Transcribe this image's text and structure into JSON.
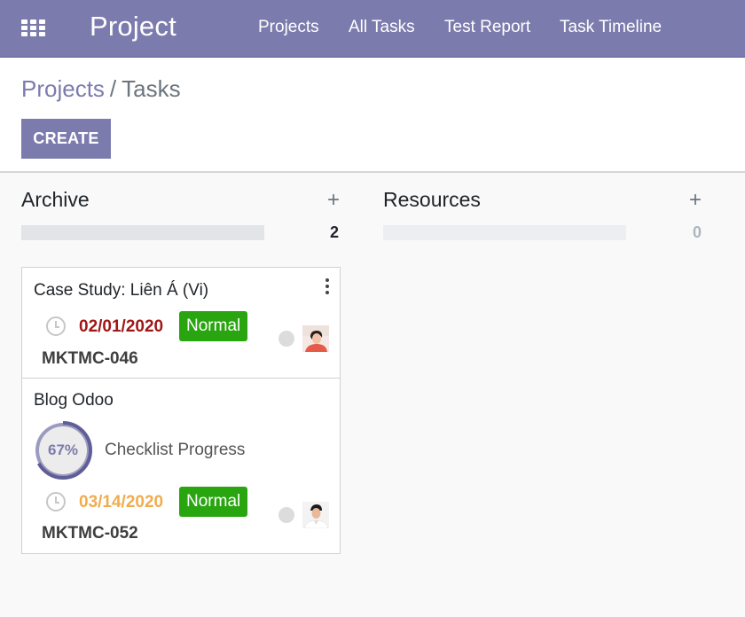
{
  "app": {
    "title": "Project",
    "menu": [
      "Projects",
      "All Tasks",
      "Test Report",
      "Task Timeline"
    ]
  },
  "breadcrumb": {
    "parent": "Projects",
    "separator": "/",
    "current": "Tasks"
  },
  "actions": {
    "create_label": "CREATE"
  },
  "columns": [
    {
      "title": "Archive",
      "plus": "+",
      "count": "2",
      "cards": [
        {
          "title": "Case Study: Liên Á (Vi)",
          "date": "02/01/2020",
          "date_color": "#a01717",
          "priority": "Normal",
          "code": "MKTMC-046",
          "avatar": "woman-avatar"
        },
        {
          "title": "Blog Odoo",
          "checklist_percent": "67%",
          "checklist_value": 67,
          "checklist_label": "Checklist Progress",
          "date": "03/14/2020",
          "date_color": "#f0ad4e",
          "priority": "Normal",
          "code": "MKTMC-052",
          "avatar": "man-avatar"
        }
      ]
    },
    {
      "title": "Resources",
      "plus": "+",
      "count": "0",
      "cards": []
    }
  ],
  "colors": {
    "brand": "#7c7bad",
    "priority_badge": "#28a50f",
    "date_overdue": "#a01717",
    "date_upcoming": "#f0ad4e"
  }
}
